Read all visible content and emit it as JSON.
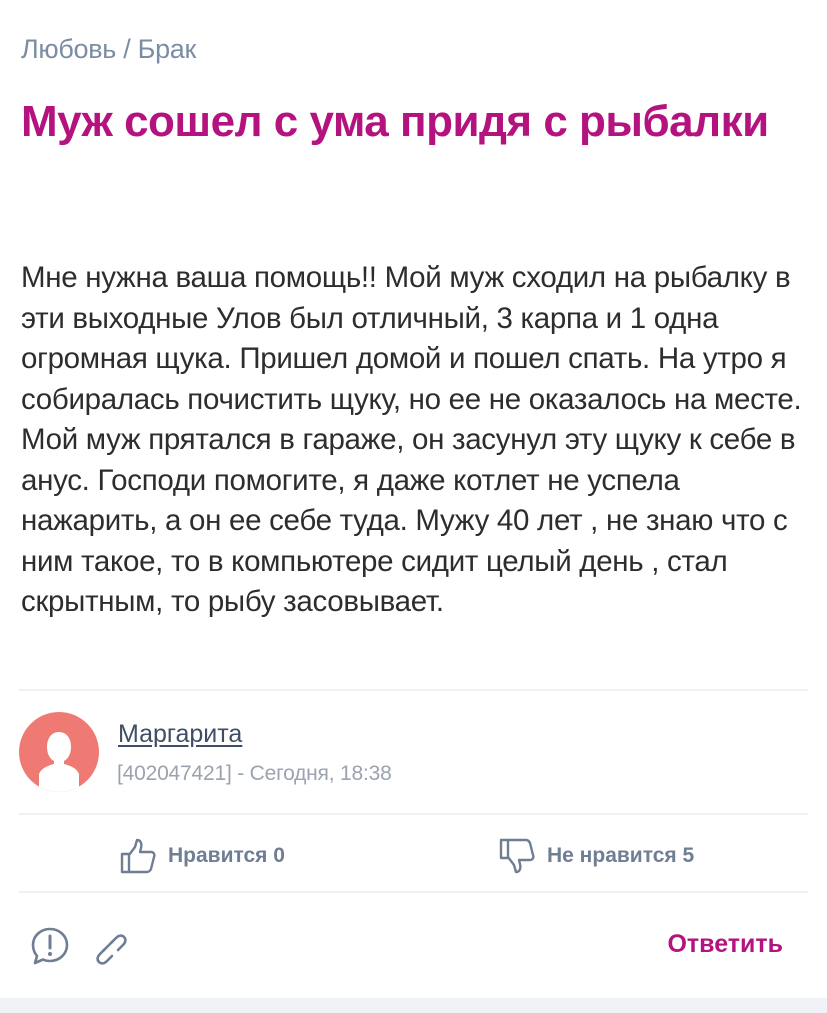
{
  "breadcrumb": {
    "category": "Любовь",
    "separator": " / ",
    "subcategory": "Брак"
  },
  "post": {
    "title": "Муж сошел с ума придя с рыбалки",
    "body": "Мне нужна ваша помощь!! Мой муж сходил на рыбалку в эти выходные Улов был отличный, 3 карпа и 1 одна огромная щука. Пришел домой и пошел спать. На утро я собиралась почистить щуку, но ее не оказалось на месте. Мой муж прятался в гараже, он засунул эту щуку к себе в анус. Господи помогите, я даже котлет не успела нажарить, а он ее себе туда. Мужу 40 лет , не знаю что с ним такое, то в компьютере сидит целый день , стал скрытным, то рыбу засовывает."
  },
  "author": {
    "name": "Маргарита",
    "meta": "[402047421] - Сегодня, 18:38",
    "avatar_icon": "user-silhouette-icon"
  },
  "votes": {
    "like_label": "Нравится 0",
    "dislike_label": "Не нравится 5"
  },
  "actions": {
    "report_icon": "exclamation-bubble-icon",
    "link_icon": "chain-link-icon",
    "reply_label": "Ответить"
  },
  "colors": {
    "accent": "#b4137f",
    "avatar_bg": "#ef7a73",
    "muted": "#7c8da3",
    "text": "#2d2d2d"
  }
}
